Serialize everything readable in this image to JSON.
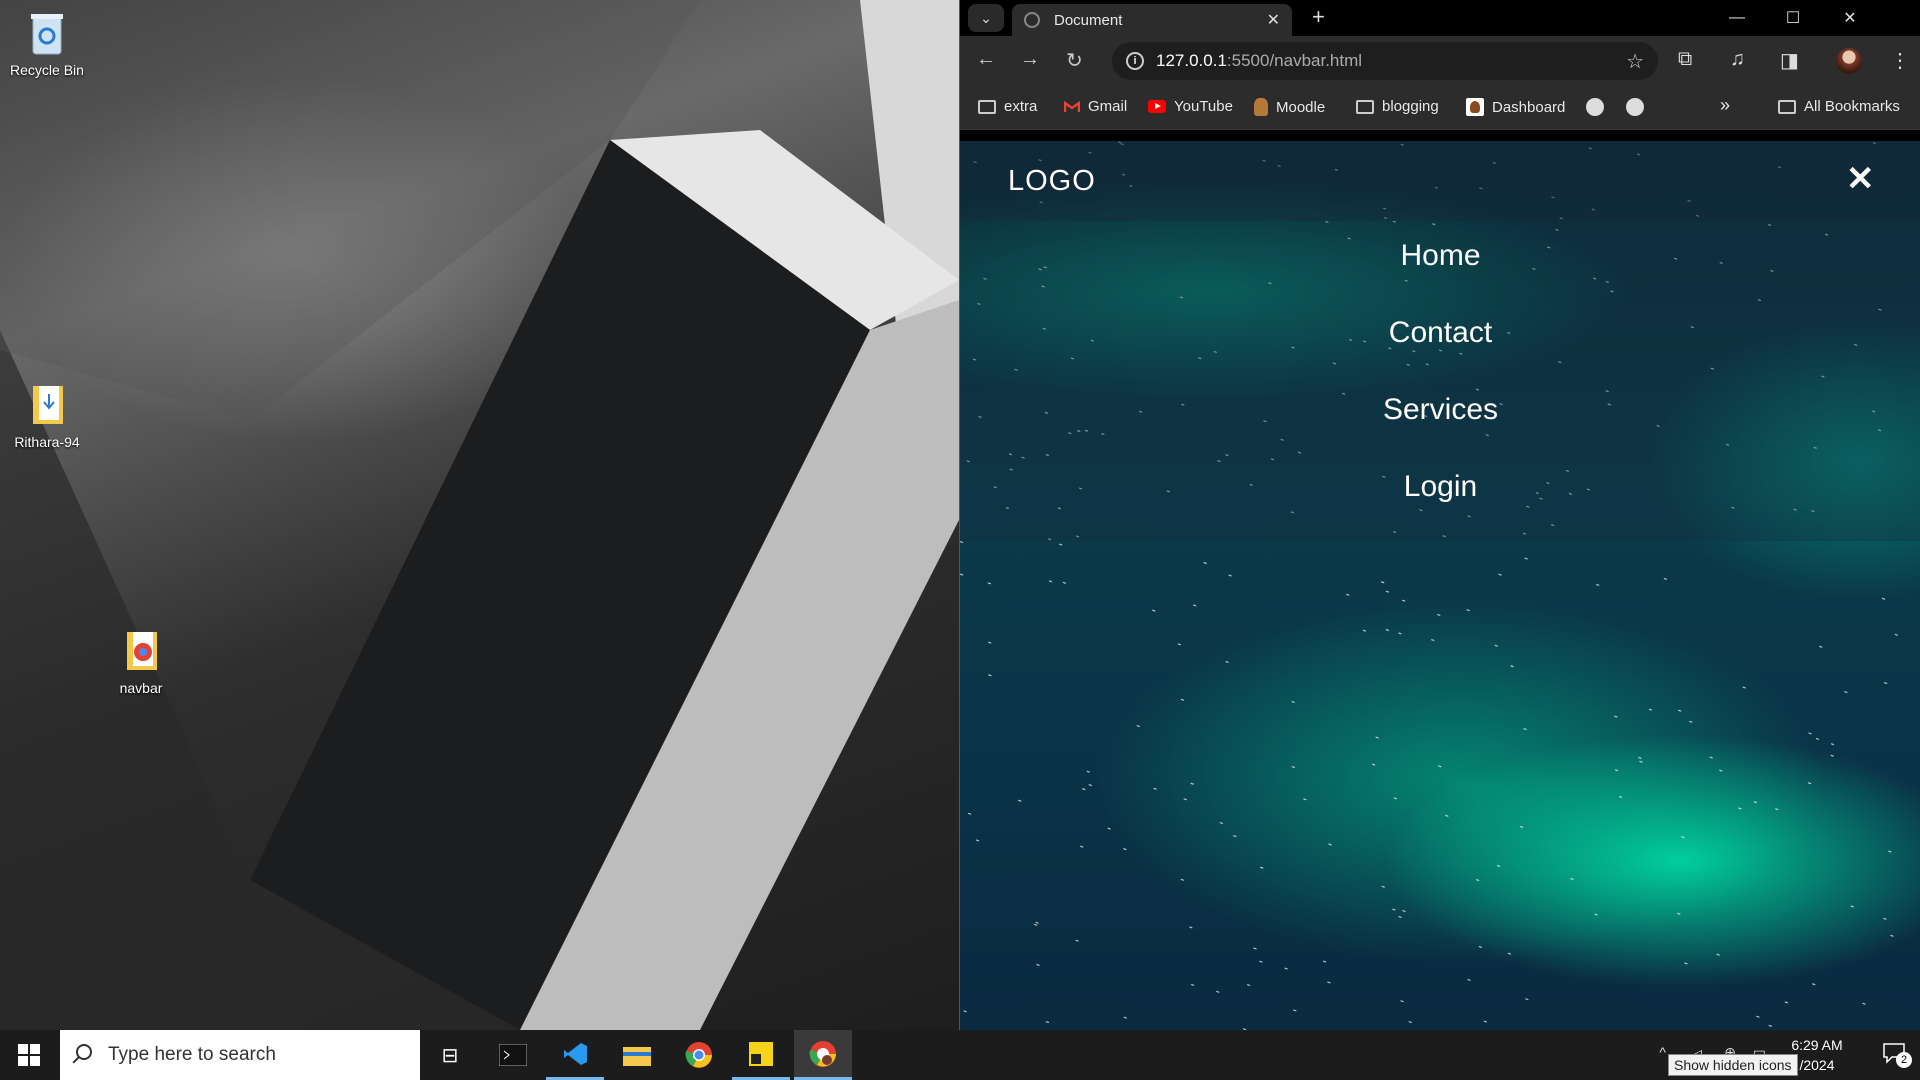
{
  "desktop": {
    "icons": [
      {
        "label": "Recycle Bin"
      },
      {
        "label": "Rithara-94"
      },
      {
        "label": "navbar"
      }
    ]
  },
  "browser": {
    "tab": {
      "title": "Document"
    },
    "address": {
      "host": "127.0.0.1",
      "path": ":5500/navbar.html"
    },
    "bookmarks": [
      {
        "label": "extra",
        "icon": "folder-icon"
      },
      {
        "label": "Gmail",
        "icon": "gmail-icon"
      },
      {
        "label": "YouTube",
        "icon": "youtube-icon"
      },
      {
        "label": "Moodle",
        "icon": "moodle-icon"
      },
      {
        "label": "blogging",
        "icon": "folder-icon"
      },
      {
        "label": "Dashboard",
        "icon": "dashboard-icon"
      }
    ],
    "all_bookmarks": "All Bookmarks"
  },
  "page": {
    "logo": "LOGO",
    "close_symbol": "✕",
    "menu": [
      "Home",
      "Contact",
      "Services",
      "Login"
    ],
    "colors": {
      "accent": "#00e0a8",
      "background": "#0a2a3a"
    }
  },
  "taskbar": {
    "search_placeholder": "Type here to search",
    "time": "6:29 AM",
    "date": "/2024",
    "tooltip": "Show hidden icons",
    "notification_count": "2"
  }
}
